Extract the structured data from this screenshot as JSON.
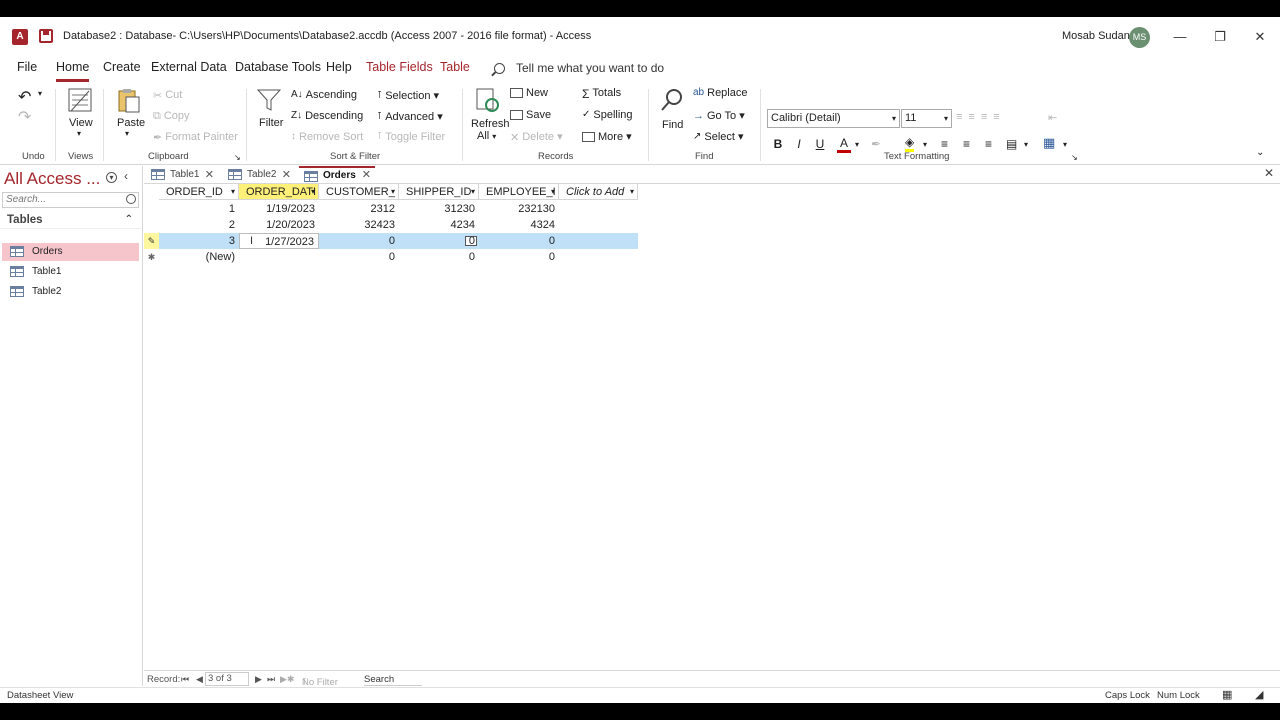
{
  "titlebar": {
    "app_icon": "A",
    "title": "Database2 : Database- C:\\Users\\HP\\Documents\\Database2.accdb (Access 2007 - 2016 file format)  -  Access",
    "user": "Mosab Sudan",
    "avatar": "MS"
  },
  "menu": {
    "file": "File",
    "home": "Home",
    "create": "Create",
    "external": "External Data",
    "dbtools": "Database Tools",
    "help": "Help",
    "table_fields": "Table Fields",
    "table": "Table",
    "tellme": "Tell me what you want to do"
  },
  "ribbon": {
    "undo_group": "Undo",
    "views_group": "Views",
    "view": "View",
    "clipboard_group": "Clipboard",
    "paste": "Paste",
    "cut": "Cut",
    "copy": "Copy",
    "format_painter": "Format Painter",
    "sortfilter_group": "Sort & Filter",
    "filter": "Filter",
    "ascending": "Ascending",
    "descending": "Descending",
    "remove_sort": "Remove Sort",
    "selection": "Selection",
    "advanced": "Advanced",
    "toggle_filter": "Toggle Filter",
    "records_group": "Records",
    "refresh": "Refresh",
    "refresh_all": "All",
    "new": "New",
    "save": "Save",
    "delete": "Delete",
    "totals": "Totals",
    "spelling": "Spelling",
    "more": "More",
    "find_group": "Find",
    "find": "Find",
    "replace": "Replace",
    "goto": "Go To",
    "select": "Select",
    "textformat_group": "Text Formatting",
    "font_name": "Calibri (Detail)",
    "font_size": "11",
    "bold": "B",
    "italic": "I",
    "underline": "U",
    "font_color": "A",
    "colors": {
      "font_red": "#c00000",
      "fill_yellow": "#ffff00"
    }
  },
  "navpane": {
    "title": "All Access ...",
    "search_placeholder": "Search...",
    "group": "Tables",
    "items": [
      {
        "label": "Orders"
      },
      {
        "label": "Table1"
      },
      {
        "label": "Table2"
      }
    ]
  },
  "doctabs": [
    {
      "label": "Table1"
    },
    {
      "label": "Table2"
    },
    {
      "label": "Orders"
    }
  ],
  "datasheet": {
    "columns": [
      "ORDER_ID",
      "ORDER_DATI",
      "CUSTOMER_",
      "SHIPPER_ID",
      "EMPLOYEE_I",
      "Click to Add"
    ],
    "rows": [
      [
        "1",
        "1/19/2023",
        "2312",
        "31230",
        "232130"
      ],
      [
        "2",
        "1/20/2023",
        "32423",
        "4234",
        "4324"
      ],
      [
        "3",
        "1/27/2023",
        "0",
        "0",
        "0"
      ],
      [
        "(New)",
        "",
        "0",
        "0",
        "0"
      ]
    ]
  },
  "recnav": {
    "label": "Record:",
    "position": "3 of 3",
    "filter": "No Filter",
    "search": "Search"
  },
  "statusbar": {
    "view": "Datasheet View",
    "caps": "Caps Lock",
    "num": "Num Lock"
  }
}
